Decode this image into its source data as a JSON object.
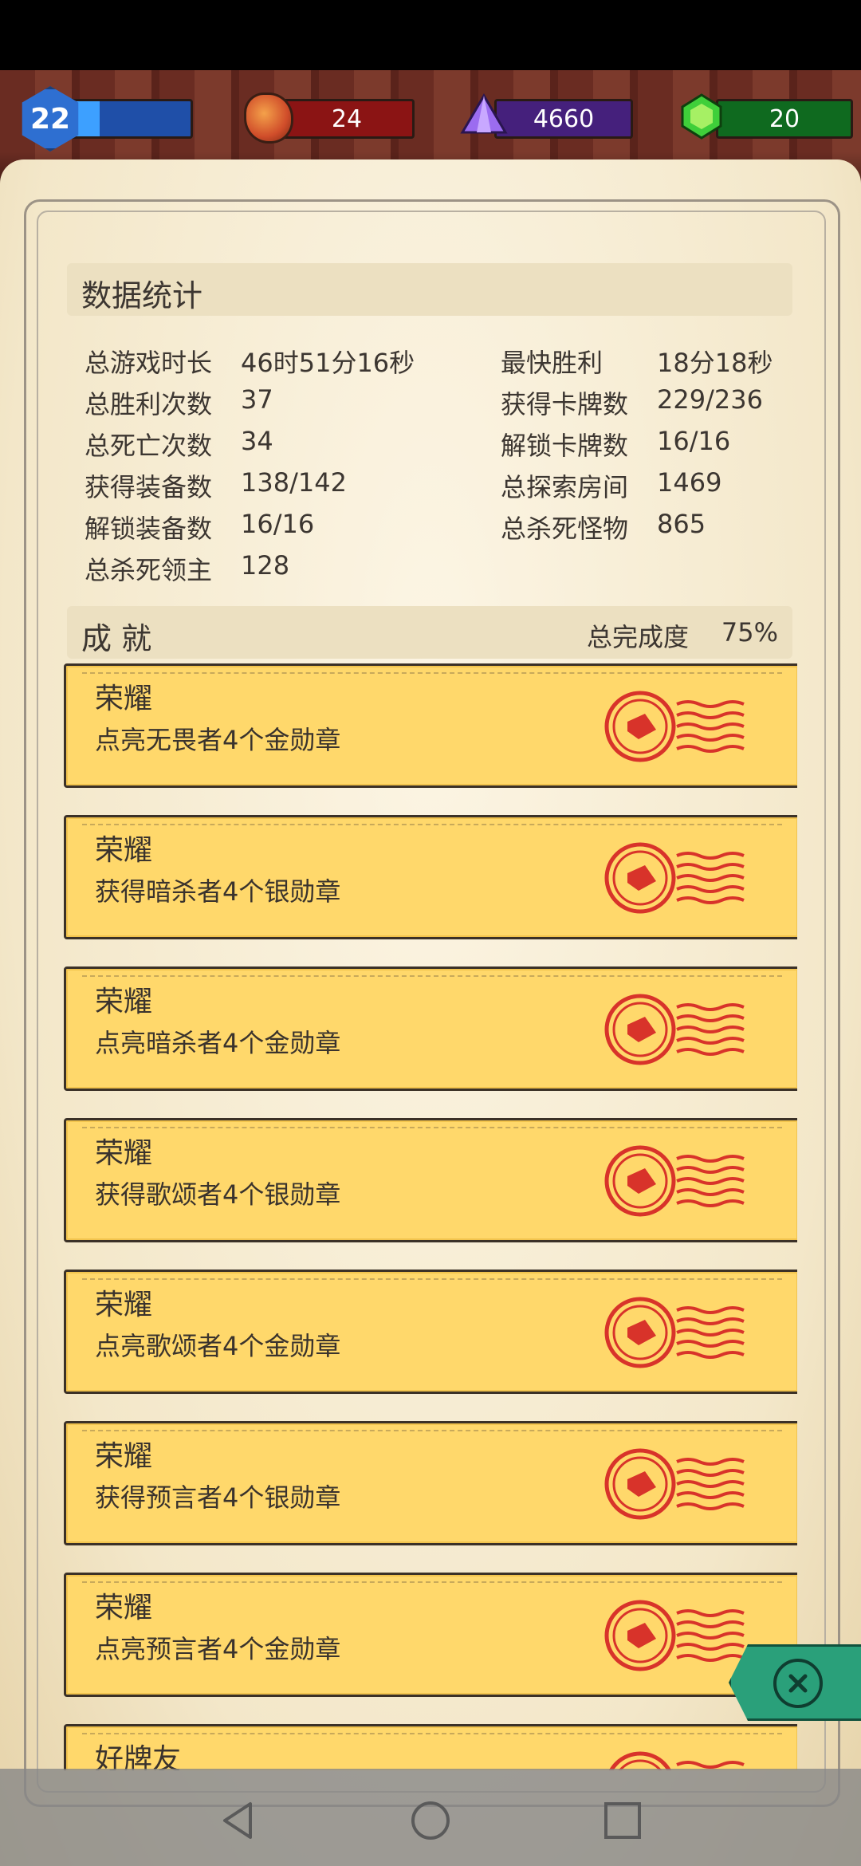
{
  "top_bar": {
    "level": "22",
    "level_progress": 0.24,
    "gold": "24",
    "crystal": "4660",
    "emerald": "20"
  },
  "stats": {
    "title": "数据统计",
    "left": [
      {
        "label": "总游戏时长",
        "value": "46时51分16秒"
      },
      {
        "label": "总胜利次数",
        "value": "37"
      },
      {
        "label": "总死亡次数",
        "value": "34"
      },
      {
        "label": "获得装备数",
        "value": "138/142"
      },
      {
        "label": "解锁装备数",
        "value": "16/16"
      },
      {
        "label": "总杀死领主",
        "value": "128"
      }
    ],
    "right": [
      {
        "label": "最快胜利",
        "value": "18分18秒"
      },
      {
        "label": "获得卡牌数",
        "value": "229/236"
      },
      {
        "label": "解锁卡牌数",
        "value": "16/16"
      },
      {
        "label": "总探索房间",
        "value": "1469"
      },
      {
        "label": "总杀死怪物",
        "value": "865"
      }
    ]
  },
  "achievements": {
    "title": "成 就",
    "progress_label": "总完成度",
    "progress_value": "75%",
    "items": [
      {
        "title": "荣耀",
        "desc": "点亮无畏者4个金勋章"
      },
      {
        "title": "荣耀",
        "desc": "获得暗杀者4个银勋章"
      },
      {
        "title": "荣耀",
        "desc": "点亮暗杀者4个金勋章"
      },
      {
        "title": "荣耀",
        "desc": "获得歌颂者4个银勋章"
      },
      {
        "title": "荣耀",
        "desc": "点亮歌颂者4个金勋章"
      },
      {
        "title": "荣耀",
        "desc": "获得预言者4个银勋章"
      },
      {
        "title": "荣耀",
        "desc": "点亮预言者4个金勋章"
      },
      {
        "title": "好牌友",
        "desc": ""
      }
    ]
  },
  "colors": {
    "card": "#ffd86b",
    "stamp": "#d8332a",
    "parchment": "#f3e7c9"
  },
  "icons": {
    "close": "close-icon",
    "nav_back": "back-icon",
    "nav_home": "home-icon",
    "nav_recent": "recent-apps-icon"
  }
}
